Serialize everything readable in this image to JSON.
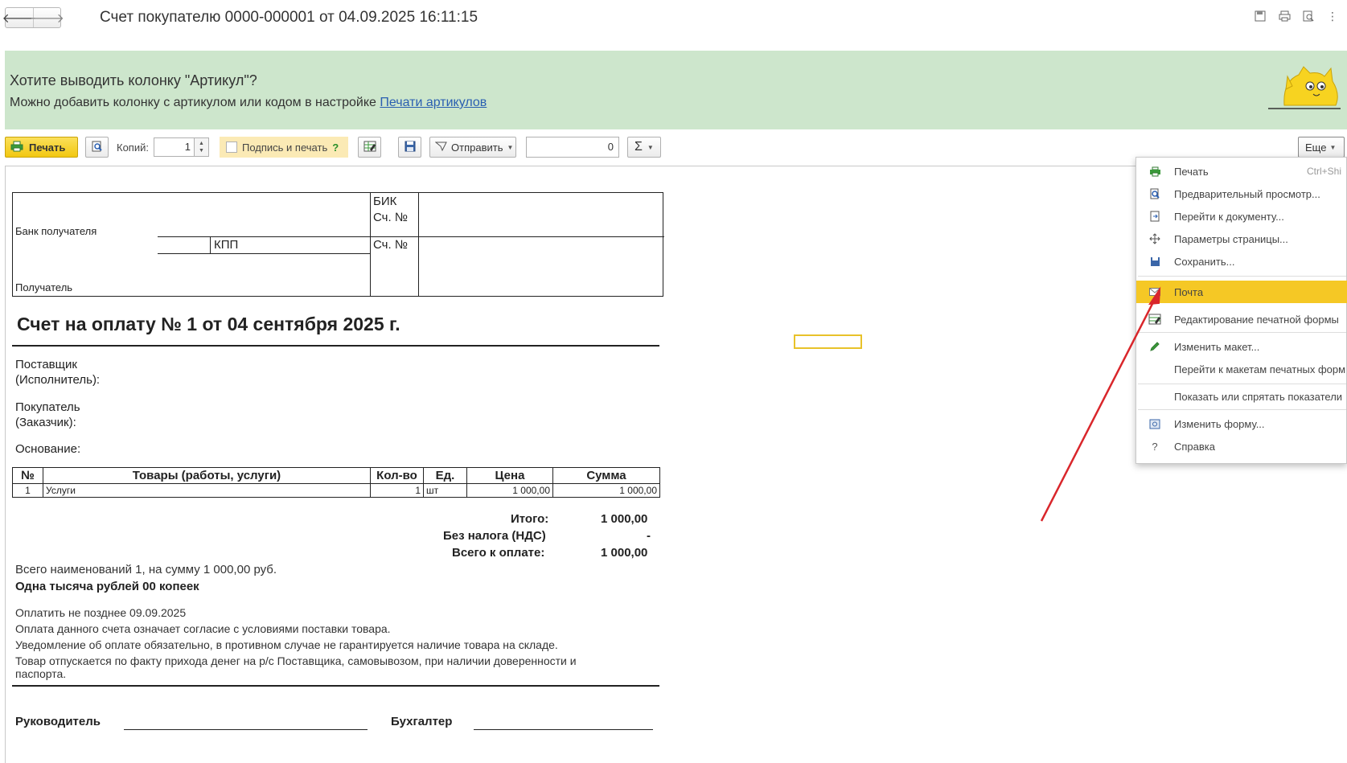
{
  "window": {
    "title": "Счет покупателю 0000-000001 от 04.09.2025 16:11:15",
    "back_icon": "arrow-left-icon",
    "forward_icon": "arrow-right-icon"
  },
  "banner": {
    "question": "Хотите выводить колонку \"Артикул\"?",
    "text": "Можно добавить колонку с артикулом или кодом в настройке",
    "link": "Печати артикулов",
    "bg_color": "#cde6cc"
  },
  "toolbar": {
    "print_label": "Печать",
    "copies_label": "Копий:",
    "copies_value": "1",
    "sign_label": "Подпись и печать",
    "sign_help": "?",
    "send_label": "Отправить",
    "sum_value": "0",
    "sigma_label": "Σ",
    "more_label": "Еще"
  },
  "bank_block": {
    "bik": "БИК",
    "acc1": "Сч. №",
    "bank_label": "Банк получателя",
    "kpp": "КПП",
    "acc2": "Сч. №",
    "recipient_label": "Получатель"
  },
  "document": {
    "title": "Счет на оплату № 1 от 04 сентября 2025 г.",
    "supplier_1": "Поставщик",
    "supplier_2": "(Исполнитель):",
    "buyer_1": "Покупатель",
    "buyer_2": "(Заказчик):",
    "basis": "Основание:",
    "columns": {
      "num": "№",
      "goods": "Товары (работы, услуги)",
      "qty": "Кол-во",
      "unit": "Ед.",
      "price": "Цена",
      "sum": "Сумма"
    },
    "row": {
      "num": "1",
      "goods": "Услуги",
      "qty": "1",
      "unit": "шт",
      "price": "1 000,00",
      "sum": "1 000,00"
    },
    "total_label": "Итого:",
    "total_value": "1 000,00",
    "vat_label": "Без налога (НДС)",
    "vat_value": "-",
    "pay_label": "Всего к оплате:",
    "pay_value": "1 000,00",
    "count_text": "Всего наименований 1, на сумму 1 000,00 руб.",
    "words_text": "Одна тысяча рублей 00 копеек",
    "terms": [
      "Оплатить не позднее 09.09.2025",
      "Оплата данного счета означает согласие с условиями поставки товара.",
      "Уведомление об оплате обязательно, в противном случае не гарантируется наличие товара на складе.",
      "Товар отпускается по факту прихода денег на р/с Поставщика, самовывозом, при наличии доверенности и",
      "паспорта."
    ],
    "director_label": "Руководитель",
    "accountant_label": "Бухгалтер"
  },
  "menu": {
    "items": [
      {
        "label": "Печать",
        "shortcut": "Ctrl+Shi",
        "icon": "printer-icon"
      },
      {
        "label": "Предварительный просмотр...",
        "icon": "preview-icon"
      },
      {
        "label": "Перейти к документу...",
        "icon": "goto-document-icon"
      },
      {
        "label": "Параметры страницы...",
        "icon": "page-settings-icon"
      },
      {
        "label": "Сохранить...",
        "icon": "save-icon"
      },
      {
        "label": "Почта",
        "icon": "mail-icon",
        "highlighted": true
      },
      {
        "label": "Редактирование печатной формы",
        "icon": "edit-form-icon"
      },
      {
        "label": "Изменить макет...",
        "icon": "pencil-icon"
      },
      {
        "label": "Перейти к макетам печатных форм"
      },
      {
        "label": "Показать или спрятать показатели"
      },
      {
        "label": "Изменить форму...",
        "icon": "form-settings-icon"
      },
      {
        "label": "Справка",
        "icon": "help-icon"
      }
    ],
    "highlight_color": "#f5c825"
  },
  "annotation": {
    "arrow_color": "#d9262b"
  }
}
